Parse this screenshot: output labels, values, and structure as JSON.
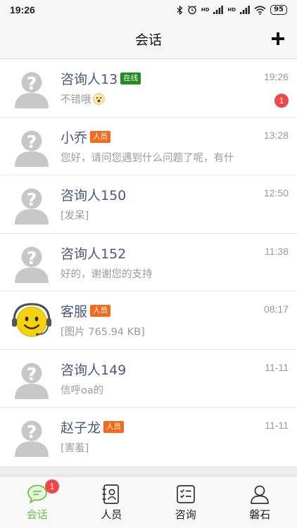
{
  "status_bar": {
    "time": "19:26",
    "battery": "95",
    "signal_1": "HD",
    "signal_2": "HD"
  },
  "header": {
    "title": "会话"
  },
  "conversations": [
    {
      "name": "咨询人13",
      "tag": "在线",
      "tag_type": "online",
      "time": "19:26",
      "message": "不错哦",
      "emoji": "surprised-emoji",
      "unread": "1",
      "avatar": "default-avatar"
    },
    {
      "name": "小乔",
      "tag": "人员",
      "tag_type": "staff",
      "time": "13:28",
      "message": "您好，请问您遇到什么问题了呢，有什",
      "emoji": "",
      "unread": "",
      "avatar": "default-avatar"
    },
    {
      "name": "咨询人150",
      "tag": "",
      "tag_type": "",
      "time": "12:50",
      "message": "[发呆]",
      "emoji": "",
      "unread": "",
      "avatar": "default-avatar"
    },
    {
      "name": "咨询人152",
      "tag": "",
      "tag_type": "",
      "time": "11:38",
      "message": "好的，谢谢您的支持",
      "emoji": "",
      "unread": "",
      "avatar": "default-avatar"
    },
    {
      "name": "客服",
      "tag": "人员",
      "tag_type": "staff",
      "time": "08:17",
      "message": "[图片 765.94 KB]",
      "emoji": "",
      "unread": "",
      "avatar": "smiley-headset-avatar"
    },
    {
      "name": "咨询人149",
      "tag": "",
      "tag_type": "",
      "time": "11-11",
      "message": "信呼oa的",
      "emoji": "",
      "unread": "",
      "avatar": "default-avatar"
    },
    {
      "name": "赵子龙",
      "tag": "人员",
      "tag_type": "staff",
      "time": "11-11",
      "message": "[害羞]",
      "emoji": "",
      "unread": "",
      "avatar": "default-avatar"
    }
  ],
  "tabs": [
    {
      "label": "会话",
      "icon": "chat-bubble-icon",
      "active": true,
      "badge": "1"
    },
    {
      "label": "人员",
      "icon": "contacts-icon",
      "active": false,
      "badge": ""
    },
    {
      "label": "咨询",
      "icon": "checklist-icon",
      "active": false,
      "badge": ""
    },
    {
      "label": "磐石",
      "icon": "person-icon",
      "active": false,
      "badge": ""
    }
  ],
  "colors": {
    "accent": "#6cc24a",
    "badge": "#f04848",
    "tag_online": "#1f8e1f",
    "tag_staff": "#f26a1b",
    "name": "#4a5a7a"
  }
}
